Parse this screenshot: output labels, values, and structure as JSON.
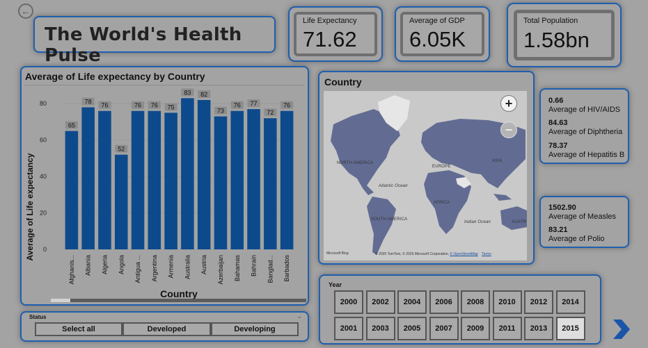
{
  "header": {
    "title": "The World's Health Pulse"
  },
  "kpis": {
    "life_expectancy": {
      "label": "Life Expectancy",
      "value": "71.62"
    },
    "gdp": {
      "label": "Average of GDP",
      "value": "6.05K"
    },
    "population": {
      "label": "Total Population",
      "value": "1.58bn"
    }
  },
  "bar_chart": {
    "title": "Average of Life expectancy by Country",
    "xlabel": "Country",
    "ylabel": "Average of Life expectancy",
    "bar_color": "#0d4a8c"
  },
  "chart_data": {
    "type": "bar",
    "title": "Average of Life expectancy by Country",
    "xlabel": "Country",
    "ylabel": "Average of Life expectancy",
    "categories": [
      "Afghanis...",
      "Albania",
      "Algeria",
      "Angola",
      "Antigua ...",
      "Argentina",
      "Armenia",
      "Australia",
      "Austria",
      "Azerbaijan",
      "Bahamas",
      "Bahrain",
      "Banglad...",
      "Barbados"
    ],
    "values": [
      65,
      78,
      76,
      52,
      76,
      76,
      75,
      83,
      82,
      73,
      76,
      77,
      72,
      76
    ],
    "yticks": [
      0,
      20,
      40,
      60,
      80
    ],
    "ylim": [
      0,
      90
    ],
    "grid": true
  },
  "map": {
    "title": "Country",
    "zoom_in": "+",
    "zoom_out": "−",
    "labels": {
      "north_america": "NORTH AMERICA",
      "europe": "EUROPE",
      "asia": "ASIA",
      "atlantic": "Atlantic Ocean",
      "africa": "AFRICA",
      "south_america": "SOUTH AMERICA",
      "indian": "Indian Ocean",
      "australia": "AUSTR"
    },
    "bing": "Microsoft Bing",
    "attribution": "© 2025 TomTom, © 2025 Microsoft Corporation,",
    "osm_link": "© OpenStreetMap",
    "terms": "Terms",
    "land_color": "#626c93",
    "ocean_color": "#c9c9c9"
  },
  "stats1": [
    {
      "value": "0.66",
      "label": "Average of HIV/AIDS"
    },
    {
      "value": "84.63",
      "label": "Average of Diphtheria"
    },
    {
      "value": "78.37",
      "label": "Average of Hepatitis B"
    }
  ],
  "stats2": [
    {
      "value": "1502.90",
      "label": "Average of Measles"
    },
    {
      "value": "83.21",
      "label": "Average of Polio"
    }
  ],
  "year_slicer": {
    "title": "Year",
    "years": [
      "2000",
      "2002",
      "2004",
      "2006",
      "2008",
      "2010",
      "2012",
      "2014",
      "2001",
      "2003",
      "2005",
      "2007",
      "2009",
      "2011",
      "2013",
      "2015"
    ],
    "selected": "2015"
  },
  "status_slicer": {
    "title": "Status",
    "options": [
      "Select all",
      "Developed",
      "Developing"
    ]
  },
  "colors": {
    "accent_border": "#1f5fae",
    "background": "#a3a3a3",
    "next_arrow": "#1a55a8"
  }
}
